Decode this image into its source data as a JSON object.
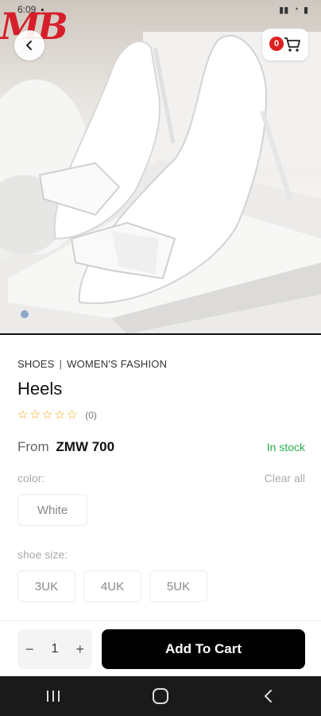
{
  "status_bar": {
    "time": "6:09",
    "right": "▮▮ ◔ ▮"
  },
  "hero": {
    "brand_text": "MB",
    "image_alt": "White heels",
    "pager_dots": 1
  },
  "header": {
    "cart_count": "0"
  },
  "product": {
    "categories": [
      "SHOES",
      "WOMEN'S FASHION"
    ],
    "category_sep": "|",
    "name": "Heels",
    "rating_count": "(0)",
    "price_prefix": "From",
    "price": "ZMW 700",
    "stock": "In stock"
  },
  "options": {
    "color_label": "color:",
    "clear_label": "Clear all",
    "colors": [
      "White"
    ],
    "size_label": "shoe size:",
    "sizes": [
      "3UK",
      "4UK",
      "5UK"
    ]
  },
  "cart_bar": {
    "minus": "−",
    "quantity": "1",
    "plus": "+",
    "add_label": "Add To Cart"
  },
  "colors": {
    "accent": "#000000",
    "badge": "#e02020",
    "in_stock": "#2bb04a",
    "star": "#f0a500"
  },
  "icons": {
    "back": "chevron-left-icon",
    "cart": "cart-icon",
    "nav_recent": "recent-apps-icon",
    "nav_home": "home-icon",
    "nav_back": "back-icon"
  }
}
